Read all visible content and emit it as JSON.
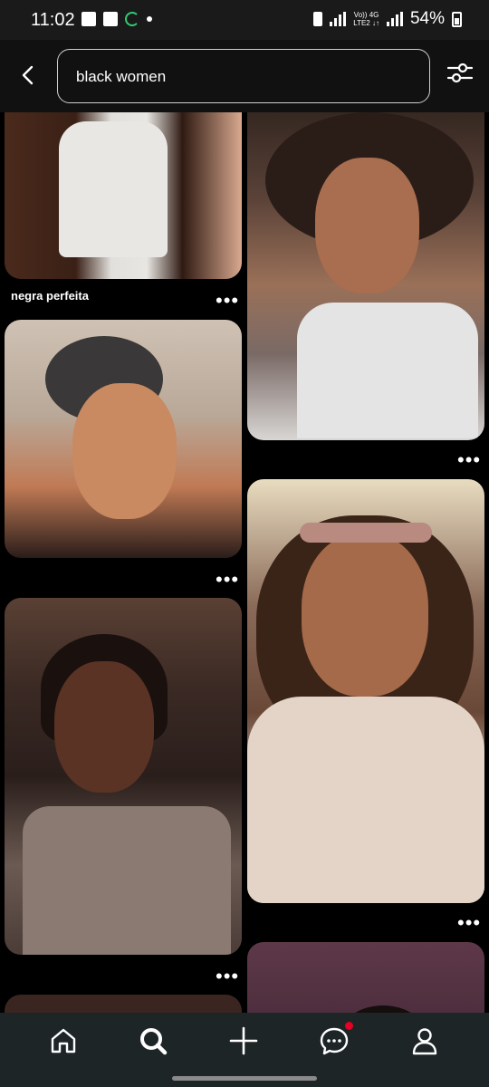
{
  "status_bar": {
    "time": "11:02",
    "network_top": "Vo)) 4G",
    "network_bottom": "LTE2 ↓↑",
    "battery": "54%"
  },
  "search": {
    "query": "black women"
  },
  "pins": [
    {
      "caption": "negra perfeita",
      "more": "•••"
    },
    {
      "caption": "",
      "more": "•••"
    },
    {
      "caption": "",
      "more": "•••"
    },
    {
      "caption": "",
      "more": "•••"
    },
    {
      "caption": "",
      "more": "•••"
    },
    {
      "caption": "",
      "more": ""
    },
    {
      "caption": "",
      "more": ""
    }
  ],
  "nav": {
    "items": [
      "home-icon",
      "search-icon",
      "create-icon",
      "messages-icon",
      "profile-icon"
    ],
    "notification_color": "#e60023"
  },
  "colors": {
    "background": "#000000",
    "status_bar": "#1a1a1a",
    "nav_bar": "#1d2526",
    "accent_ring": "#2ecc71"
  }
}
